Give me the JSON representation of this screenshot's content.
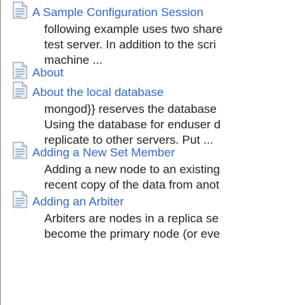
{
  "colors": {
    "link": "#3366cc",
    "text": "#222222",
    "rule": "#8a8a8a"
  },
  "results": [
    {
      "icon": "page-icon",
      "title": "A Sample Configuration Session",
      "excerpt": [
        "following example uses two share",
        "test server. In addition to the scri",
        "machine ..."
      ]
    },
    {
      "icon": "page-icon",
      "title": "About",
      "excerpt": []
    },
    {
      "icon": "page-icon",
      "title": "About the local database",
      "excerpt": [
        "mongod}} reserves the database",
        "Using the database for enduser d",
        "replicate to other servers. Put ..."
      ]
    },
    {
      "icon": "page-icon",
      "title": "Adding a New Set Member",
      "excerpt": [
        "Adding a new node to an existing",
        "recent copy of the data from anot"
      ]
    },
    {
      "icon": "page-icon",
      "title": "Adding an Arbiter",
      "excerpt": [
        "Arbiters are nodes in a replica se",
        "become the primary node (or eve"
      ]
    }
  ]
}
